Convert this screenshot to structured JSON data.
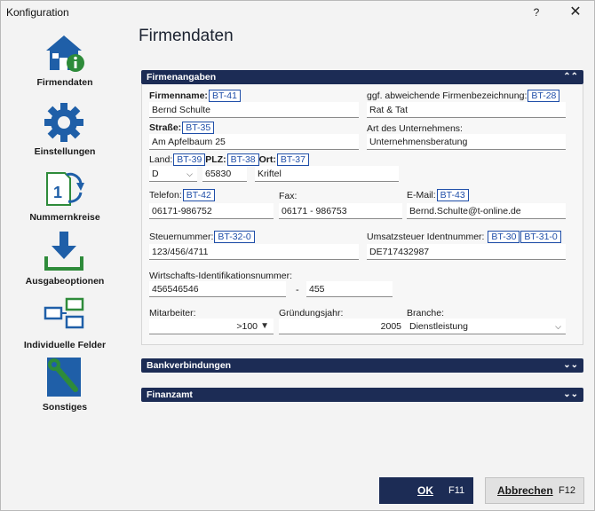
{
  "window": {
    "title": "Konfiguration",
    "help": "?",
    "close": "✕"
  },
  "sidebar": {
    "items": [
      {
        "label": "Firmendaten",
        "icon": "house-info-icon"
      },
      {
        "label": "Einstellungen",
        "icon": "gear-icon"
      },
      {
        "label": "Nummernkreise",
        "icon": "number-cycle-icon"
      },
      {
        "label": "Ausgabeoptionen",
        "icon": "download-tray-icon"
      },
      {
        "label": "Individuelle Felder",
        "icon": "fields-icon"
      },
      {
        "label": "Sonstiges",
        "icon": "wrench-icon"
      }
    ]
  },
  "page": {
    "title": "Firmendaten"
  },
  "firmenangaben": {
    "header": "Firmenangaben",
    "firmenname_label": "Firmenname:",
    "firmenname_bt": "BT-41",
    "firmenname": "Bernd Schulte",
    "abw_label": "ggf. abweichende Firmenbezeichnung:",
    "abw_bt": "BT-28",
    "abw": "Rat & Tat",
    "strasse_label": "Straße:",
    "strasse_bt": "BT-35",
    "strasse": "Am Apfelbaum 25",
    "art_label": "Art des Unternehmens:",
    "art": "Unternehmensberatung",
    "land_label": "Land:",
    "land_bt": "BT-39",
    "land": "D",
    "plz_label": "PLZ:",
    "plz_bt": "BT-38",
    "plz": "65830",
    "ort_label": "Ort:",
    "ort_bt": "BT-37",
    "ort": "Kriftel",
    "telefon_label": "Telefon:",
    "telefon_bt": "BT-42",
    "telefon": "06171-986752",
    "fax_label": "Fax:",
    "fax": "06171 - 986753",
    "email_label": "E-Mail:",
    "email_bt": "BT-43",
    "email": "Bernd.Schulte@t-online.de",
    "steuer_label": "Steuernummer:",
    "steuer_bt": "BT-32-0",
    "steuer": "123/456/4711",
    "ust_label": "Umsatzsteuer Identnummer:",
    "ust_bt1": "BT-30",
    "ust_bt2": "BT-31-0",
    "ust": "DE717432987",
    "wid_label": "Wirtschafts-Identifikationsnummer:",
    "wid": "456546546",
    "wid_dash": "-",
    "wid_suffix": "455",
    "mitarbeiter_label": "Mitarbeiter:",
    "mitarbeiter": ">100",
    "gruendung_label": "Gründungsjahr:",
    "gruendung": "2005",
    "branche_label": "Branche:",
    "branche": "Dienstleistung"
  },
  "sections": {
    "bank": "Bankverbindungen",
    "finanzamt": "Finanzamt"
  },
  "buttons": {
    "ok": "OK",
    "ok_key": "F11",
    "cancel": "Abbrechen",
    "cancel_key": "F12"
  },
  "colors": {
    "accent": "#1c2c55",
    "bt_border": "#1f4ea8",
    "icon_blue": "#1f5fa8",
    "icon_green": "#2e8b3a"
  }
}
